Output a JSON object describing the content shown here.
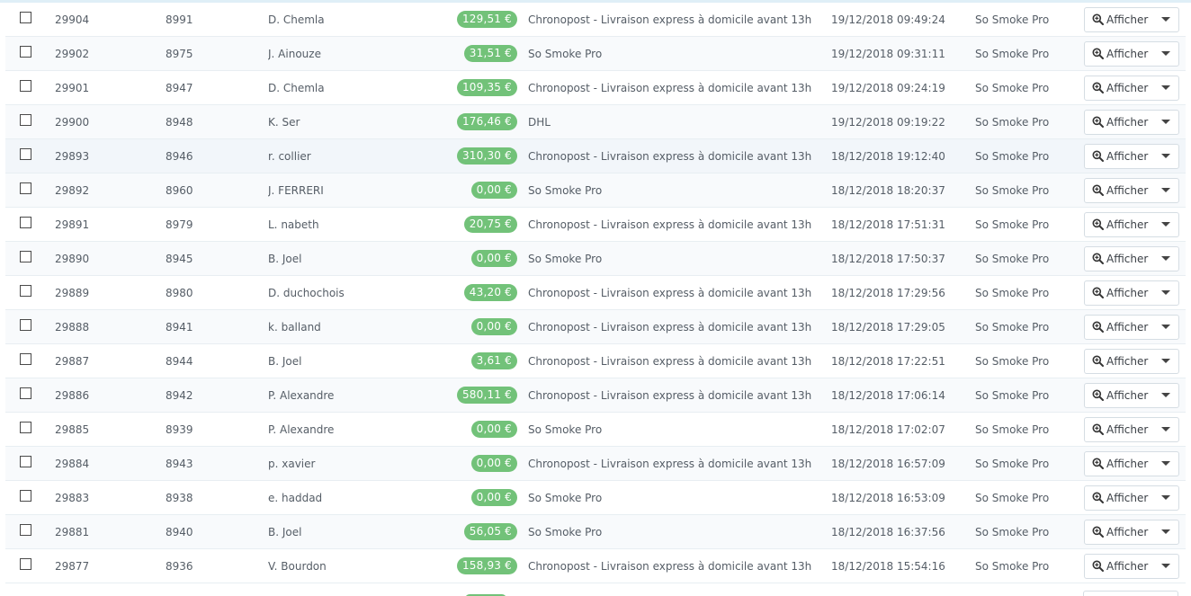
{
  "actions": {
    "view_label": "Afficher"
  },
  "orders": [
    {
      "id": "29904",
      "customer_id": "8991",
      "name": "D. Chemla",
      "total": "129,51 €",
      "carrier": "Chronopost - Livraison express à domicile avant 13h",
      "date": "19/12/2018 09:49:24",
      "shop": "So Smoke Pro"
    },
    {
      "id": "29902",
      "customer_id": "8975",
      "name": "J. Ainouze",
      "total": "31,51 €",
      "carrier": "So Smoke Pro",
      "date": "19/12/2018 09:31:11",
      "shop": "So Smoke Pro"
    },
    {
      "id": "29901",
      "customer_id": "8947",
      "name": "D. Chemla",
      "total": "109,35 €",
      "carrier": "Chronopost - Livraison express à domicile avant 13h",
      "date": "19/12/2018 09:24:19",
      "shop": "So Smoke Pro"
    },
    {
      "id": "29900",
      "customer_id": "8948",
      "name": "K. Ser",
      "total": "176,46 €",
      "carrier": "DHL",
      "date": "19/12/2018 09:19:22",
      "shop": "So Smoke Pro"
    },
    {
      "id": "29893",
      "customer_id": "8946",
      "name": "r. collier",
      "total": "310,30 €",
      "carrier": "Chronopost - Livraison express à domicile avant 13h",
      "date": "18/12/2018 19:12:40",
      "shop": "So Smoke Pro"
    },
    {
      "id": "29892",
      "customer_id": "8960",
      "name": "J. FERRERI",
      "total": "0,00 €",
      "carrier": "So Smoke Pro",
      "date": "18/12/2018 18:20:37",
      "shop": "So Smoke Pro"
    },
    {
      "id": "29891",
      "customer_id": "8979",
      "name": "L. nabeth",
      "total": "20,75 €",
      "carrier": "Chronopost - Livraison express à domicile avant 13h",
      "date": "18/12/2018 17:51:31",
      "shop": "So Smoke Pro"
    },
    {
      "id": "29890",
      "customer_id": "8945",
      "name": "B. Joel",
      "total": "0,00 €",
      "carrier": "So Smoke Pro",
      "date": "18/12/2018 17:50:37",
      "shop": "So Smoke Pro"
    },
    {
      "id": "29889",
      "customer_id": "8980",
      "name": "D. duchochois",
      "total": "43,20 €",
      "carrier": "Chronopost - Livraison express à domicile avant 13h",
      "date": "18/12/2018 17:29:56",
      "shop": "So Smoke Pro"
    },
    {
      "id": "29888",
      "customer_id": "8941",
      "name": "k. balland",
      "total": "0,00 €",
      "carrier": "Chronopost - Livraison express à domicile avant 13h",
      "date": "18/12/2018 17:29:05",
      "shop": "So Smoke Pro"
    },
    {
      "id": "29887",
      "customer_id": "8944",
      "name": "B. Joel",
      "total": "3,61 €",
      "carrier": "Chronopost - Livraison express à domicile avant 13h",
      "date": "18/12/2018 17:22:51",
      "shop": "So Smoke Pro"
    },
    {
      "id": "29886",
      "customer_id": "8942",
      "name": "P. Alexandre",
      "total": "580,11 €",
      "carrier": "Chronopost - Livraison express à domicile avant 13h",
      "date": "18/12/2018 17:06:14",
      "shop": "So Smoke Pro"
    },
    {
      "id": "29885",
      "customer_id": "8939",
      "name": "P. Alexandre",
      "total": "0,00 €",
      "carrier": "So Smoke Pro",
      "date": "18/12/2018 17:02:07",
      "shop": "So Smoke Pro"
    },
    {
      "id": "29884",
      "customer_id": "8943",
      "name": "p. xavier",
      "total": "0,00 €",
      "carrier": "Chronopost - Livraison express à domicile avant 13h",
      "date": "18/12/2018 16:57:09",
      "shop": "So Smoke Pro"
    },
    {
      "id": "29883",
      "customer_id": "8938",
      "name": "e. haddad",
      "total": "0,00 €",
      "carrier": "So Smoke Pro",
      "date": "18/12/2018 16:53:09",
      "shop": "So Smoke Pro"
    },
    {
      "id": "29881",
      "customer_id": "8940",
      "name": "B. Joel",
      "total": "56,05 €",
      "carrier": "So Smoke Pro",
      "date": "18/12/2018 16:37:56",
      "shop": "So Smoke Pro"
    },
    {
      "id": "29877",
      "customer_id": "8936",
      "name": "V. Bourdon",
      "total": "158,93 €",
      "carrier": "Chronopost - Livraison express à domicile avant 13h",
      "date": "18/12/2018 15:54:16",
      "shop": "So Smoke Pro"
    }
  ],
  "colors": {
    "badge": "#72c279",
    "row_border": "#e8eef2",
    "row_alt": "#f8fafc"
  }
}
